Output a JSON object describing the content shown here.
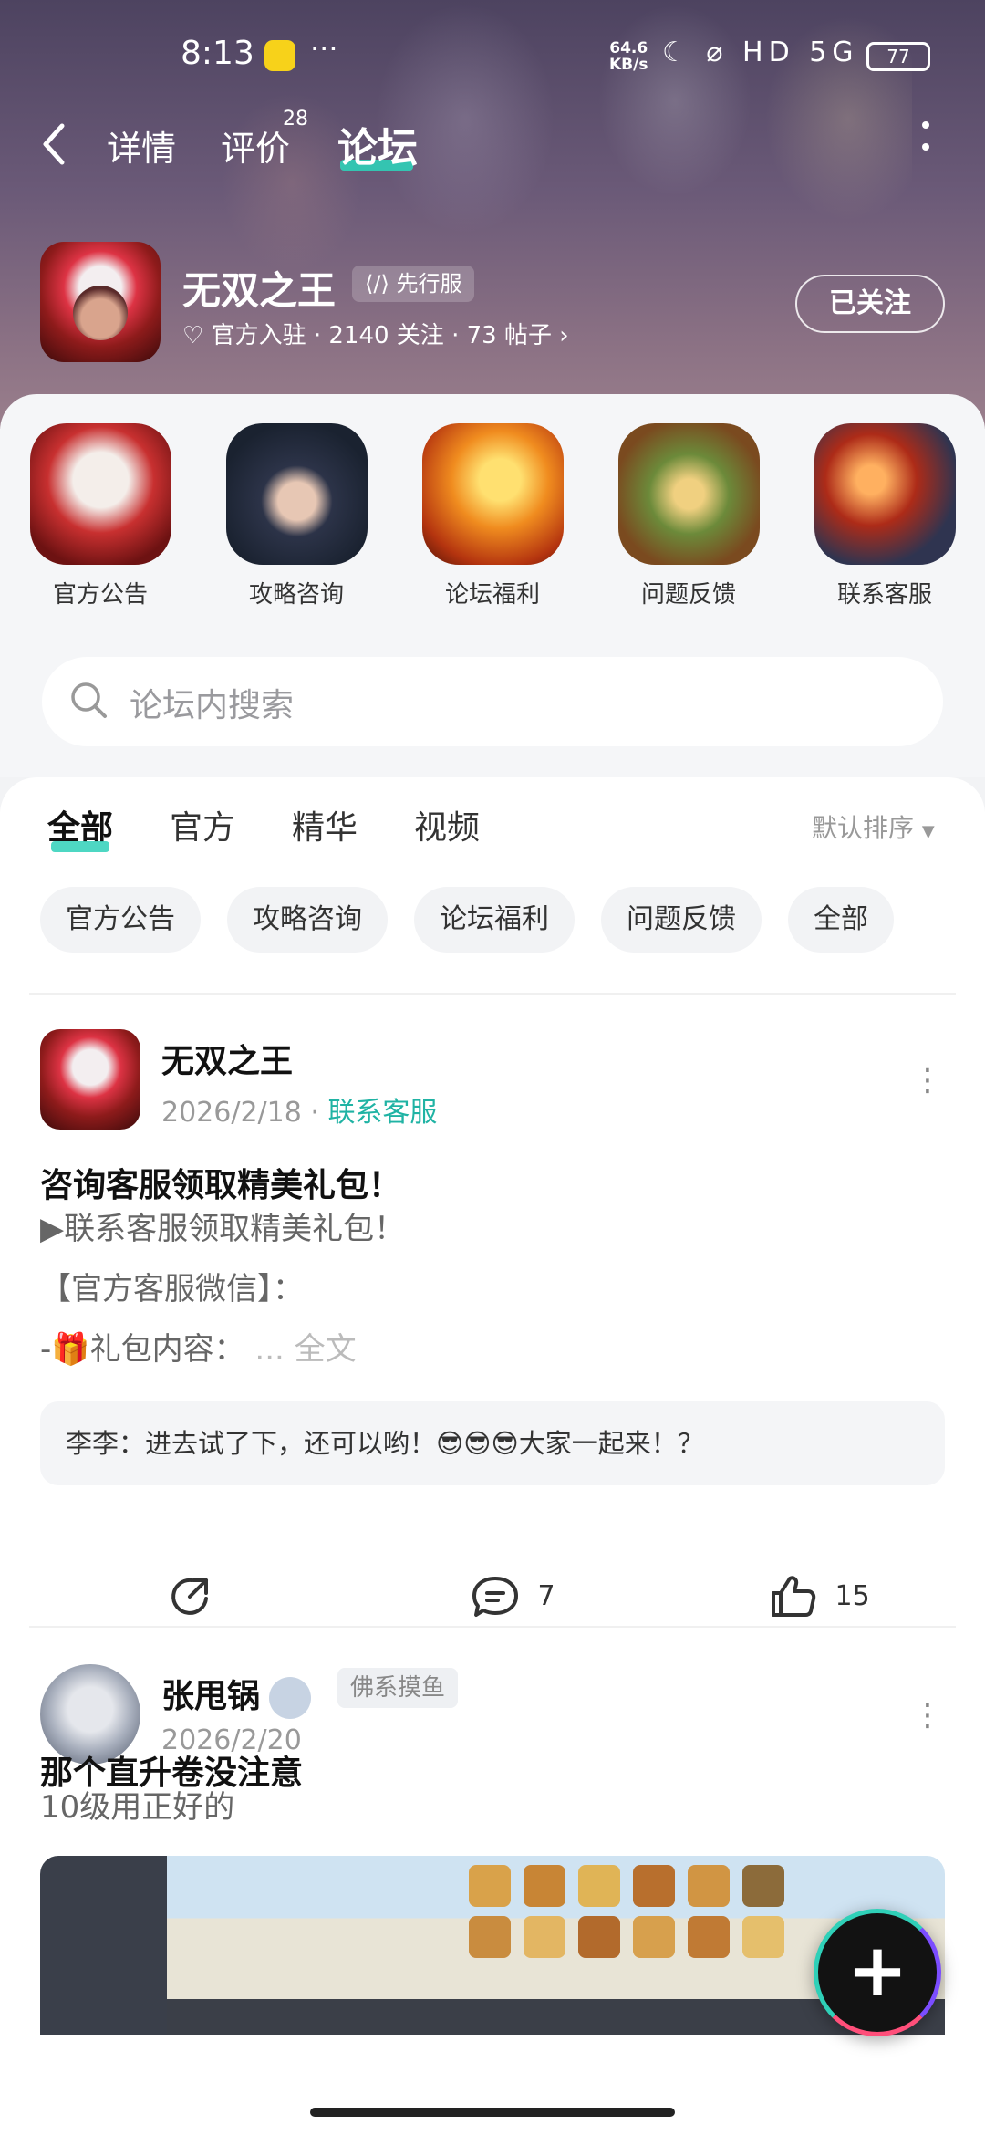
{
  "status_bar": {
    "time": "8:13",
    "dots": "···",
    "net_speed_value": "64.6",
    "net_speed_unit": "KB/s",
    "icons": "☾ ⌀ HD 5G",
    "battery": "77"
  },
  "nav": {
    "tabs": [
      {
        "label": "详情"
      },
      {
        "label": "评价",
        "badge": "28"
      },
      {
        "label": "论坛"
      }
    ],
    "active_tab": "论坛"
  },
  "game": {
    "name": "无双之王",
    "server_tag": "先行服",
    "meta": "官方入驻 · 2140 关注 · 73 帖子",
    "follow_label": "已关注"
  },
  "shortcuts": [
    {
      "label": "官方公告"
    },
    {
      "label": "攻略咨询"
    },
    {
      "label": "论坛福利"
    },
    {
      "label": "问题反馈"
    },
    {
      "label": "联系客服"
    }
  ],
  "search": {
    "placeholder": "论坛内搜索"
  },
  "filter_tabs": [
    {
      "label": "全部"
    },
    {
      "label": "官方"
    },
    {
      "label": "精华"
    },
    {
      "label": "视频"
    }
  ],
  "sort_label": "默认排序",
  "category_chips": [
    {
      "label": "官方公告"
    },
    {
      "label": "攻略咨询"
    },
    {
      "label": "论坛福利"
    },
    {
      "label": "问题反馈"
    },
    {
      "label": "全部"
    }
  ],
  "posts": [
    {
      "author": "无双之王",
      "date": "2026/2/18",
      "section": "联系客服",
      "title": "咨询客服领取精美礼包！",
      "body_lines": [
        "▶联系客服领取精美礼包！",
        "【官方客服微信】：",
        "-🎁礼包内容："
      ],
      "fulltext": "... 全文",
      "top_comment": "李李：进去试了下，还可以哟！😎😎😎大家一起来！？",
      "comments": "7",
      "likes": "15"
    },
    {
      "author": "张甩锅",
      "role": "佛系摸鱼",
      "date": "2026/2/20",
      "title": "那个直升卷没注意",
      "body": "10级用正好的"
    }
  ],
  "colors": {
    "accent": "#2fd0b8",
    "link": "#20b3a4",
    "header_bg": "#5b4d6b"
  }
}
